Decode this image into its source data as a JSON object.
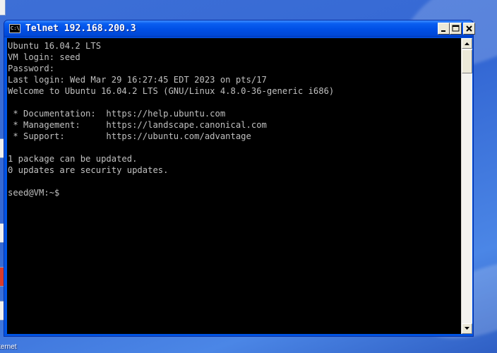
{
  "window": {
    "title": "Telnet 192.168.200.3",
    "icon": "console-icon",
    "icon_text": "C:\\"
  },
  "desktop": {
    "partial_label": "ternet"
  },
  "terminal": {
    "lines": [
      "Ubuntu 16.04.2 LTS",
      "VM login: seed",
      "Password:",
      "Last login: Wed Mar 29 16:27:45 EDT 2023 on pts/17",
      "Welcome to Ubuntu 16.04.2 LTS (GNU/Linux 4.8.0-36-generic i686)",
      "",
      " * Documentation:  https://help.ubuntu.com",
      " * Management:     https://landscape.canonical.com",
      " * Support:        https://ubuntu.com/advantage",
      "",
      "1 package can be updated.",
      "0 updates are security updates.",
      "",
      "seed@VM:~$"
    ]
  },
  "colors": {
    "terminal_background": "#000000",
    "terminal_text": "#c0c0c0",
    "titlebar": "#0054e3"
  }
}
